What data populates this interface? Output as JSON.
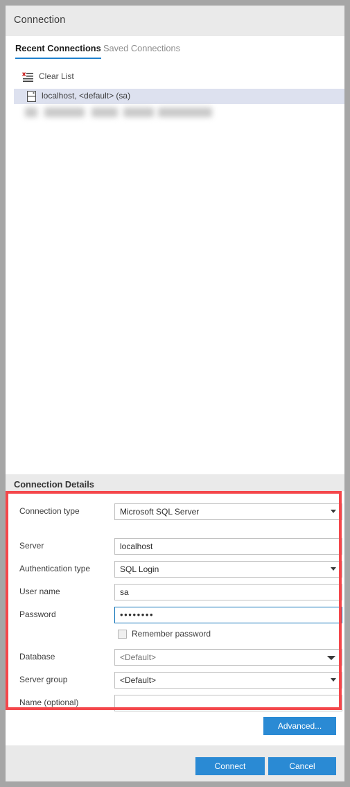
{
  "window": {
    "title": "Connection"
  },
  "tabs": [
    {
      "label": "Recent Connections",
      "active": true
    },
    {
      "label": "Saved Connections",
      "active": false
    }
  ],
  "list": {
    "clear_list_label": "Clear List",
    "clear_list_icon": "clear-list-icon",
    "connections": [
      {
        "label": "localhost, <default> (sa)",
        "icon": "server-icon",
        "selected": true
      },
      {
        "label": "",
        "icon": "server-icon",
        "selected": false,
        "redacted": true
      }
    ]
  },
  "details": {
    "header": "Connection Details",
    "fields": {
      "connection_type": {
        "label": "Connection type",
        "value": "Microsoft SQL Server",
        "control": "dropdown"
      },
      "server": {
        "label": "Server",
        "value": "localhost",
        "control": "textbox"
      },
      "authentication_type": {
        "label": "Authentication type",
        "value": "SQL Login",
        "control": "dropdown"
      },
      "user_name": {
        "label": "User name",
        "value": "sa",
        "control": "textbox"
      },
      "password": {
        "label": "Password",
        "value": "••••••••",
        "control": "password",
        "focused": true
      },
      "remember_password": {
        "label": "Remember password",
        "checked": false,
        "control": "checkbox"
      },
      "database": {
        "label": "Database",
        "value": "<Default>",
        "control": "dropdown"
      },
      "server_group": {
        "label": "Server group",
        "value": "<Default>",
        "control": "dropdown"
      },
      "name_optional": {
        "label": "Name (optional)",
        "value": "",
        "control": "textbox"
      }
    },
    "advanced_label": "Advanced..."
  },
  "footer": {
    "connect_label": "Connect",
    "cancel_label": "Cancel"
  },
  "colors": {
    "accent_blue": "#2a8ad4",
    "tab_underline": "#1d7fcd",
    "focus_border": "#0f73b8",
    "highlight_red": "#f4474b",
    "selected_row": "#dde1ef",
    "header_gray": "#eaeaea",
    "footer_gray": "#e9e9e9",
    "window_border": "#a6a6a6"
  }
}
